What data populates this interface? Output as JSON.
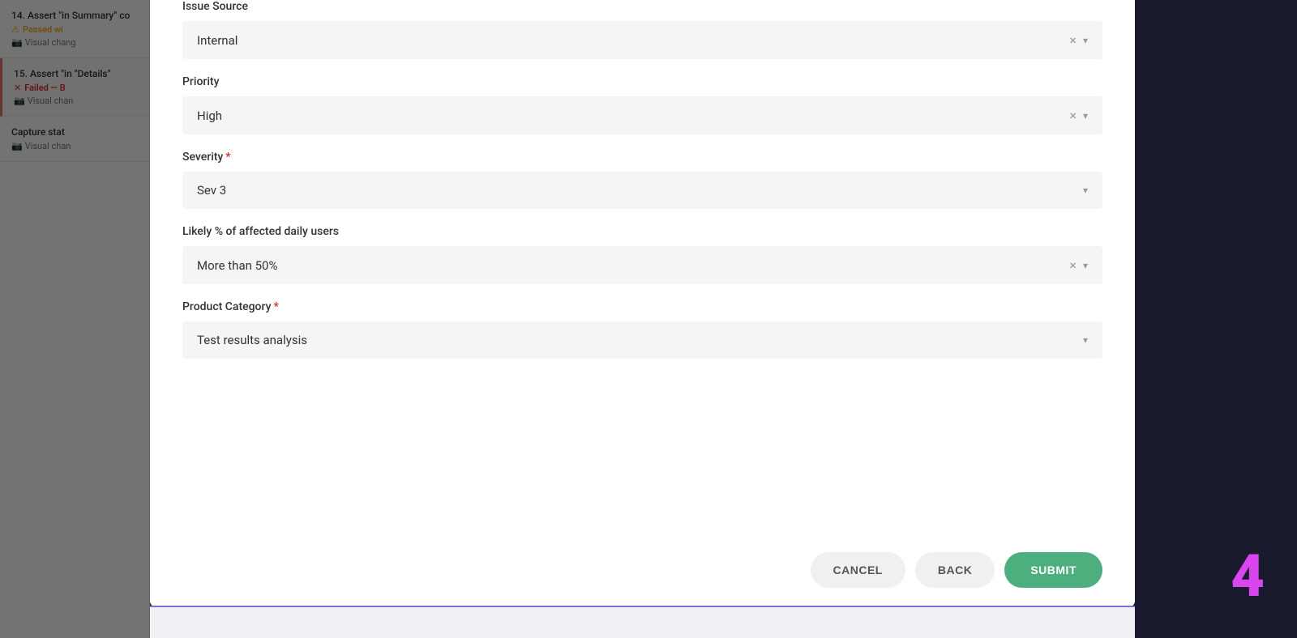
{
  "background": {
    "items": [
      {
        "id": "item-14",
        "title": "14. Assert \"in Summary\" co",
        "status_icon": "warning",
        "status_text": "Passed wi",
        "visual_text": "Visual chang"
      },
      {
        "id": "item-15",
        "title": "15. Assert \"in \"Details\"",
        "status_icon": "x",
        "status_text": "Failed — B",
        "visual_text": "Visual chan",
        "failed": true
      },
      {
        "id": "item-capture",
        "title": "Capture stat",
        "status_icon": "camera",
        "visual_text": "Visual chan"
      }
    ]
  },
  "modal": {
    "sections": [
      {
        "id": "issue-source",
        "label": "Issue Source",
        "required": false,
        "value": "Internal",
        "has_clear": true,
        "has_arrow": true
      },
      {
        "id": "priority",
        "label": "Priority",
        "required": false,
        "value": "High",
        "has_clear": true,
        "has_arrow": true
      },
      {
        "id": "severity",
        "label": "Severity",
        "required": true,
        "value": "Sev 3",
        "has_clear": false,
        "has_arrow": true
      },
      {
        "id": "likely-percent",
        "label": "Likely % of affected daily users",
        "required": false,
        "value": "More than 50%",
        "has_clear": true,
        "has_arrow": true
      },
      {
        "id": "product-category",
        "label": "Product Category",
        "required": true,
        "value": "Test results analysis",
        "has_clear": false,
        "has_arrow": true
      }
    ],
    "footer": {
      "cancel_label": "CANCEL",
      "back_label": "BACK",
      "submit_label": "SUBMIT"
    }
  },
  "step": {
    "number": "4"
  }
}
